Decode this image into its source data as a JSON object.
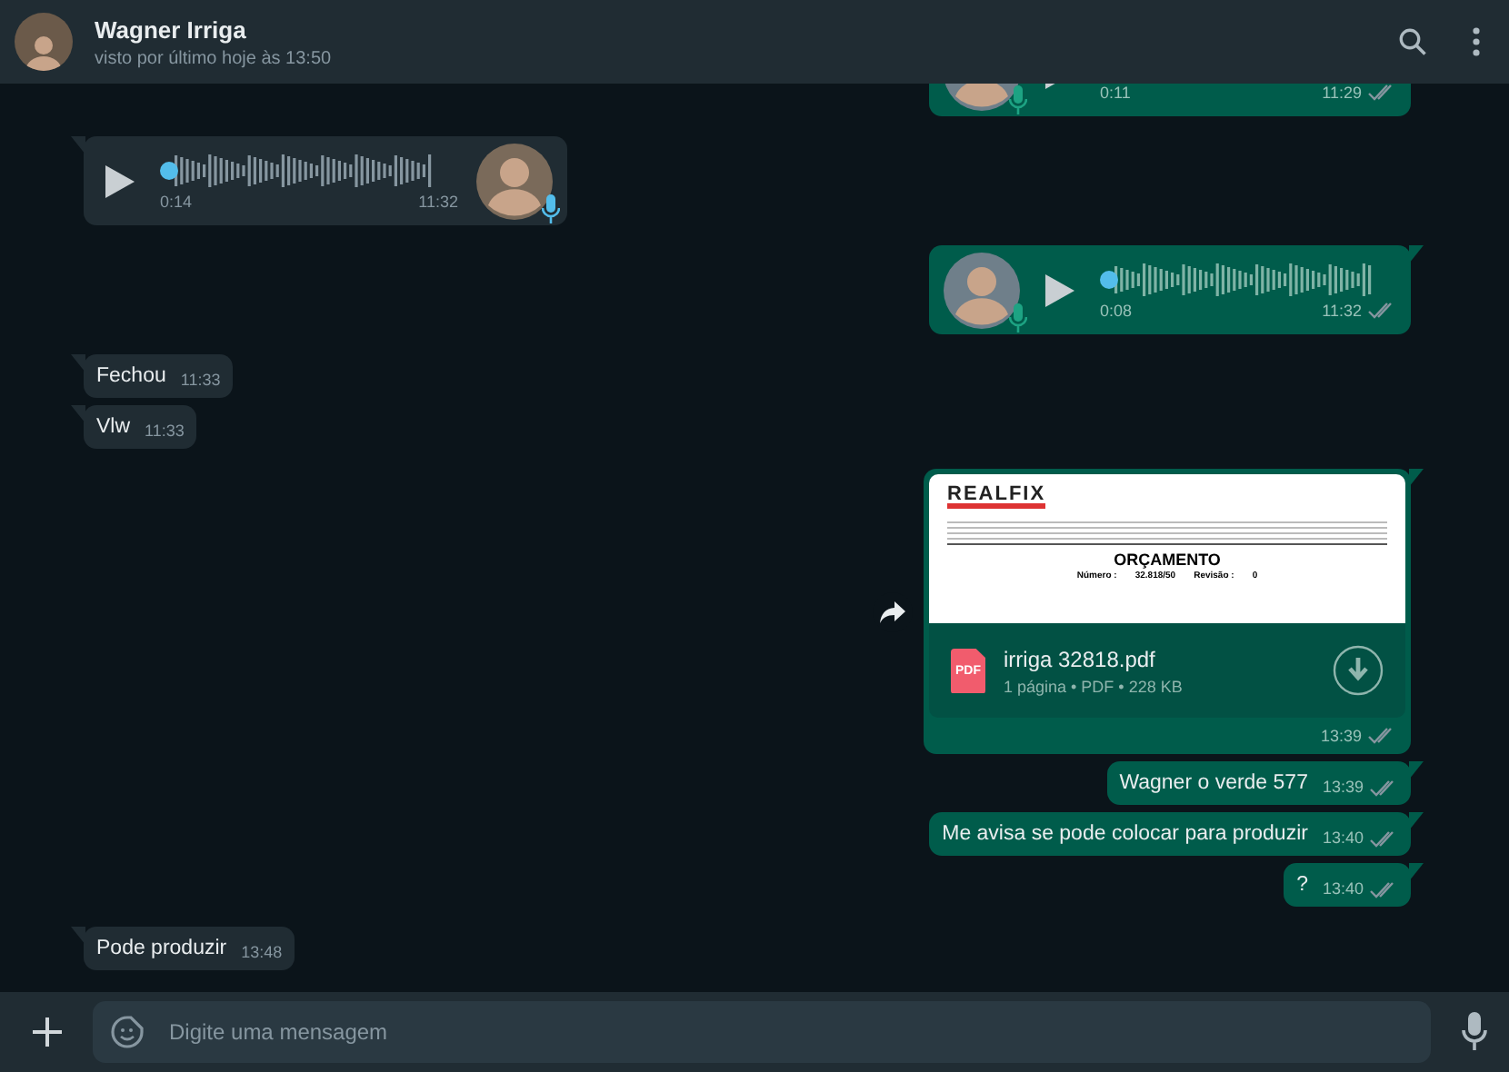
{
  "header": {
    "name": "Wagner Irriga",
    "status": "visto por último hoje às 13:50"
  },
  "messages": [
    {
      "kind": "voice",
      "outgoing": true,
      "duration": "0:11",
      "time": "11:29",
      "read": false
    },
    {
      "kind": "voice",
      "outgoing": false,
      "duration": "0:14",
      "time": "11:32",
      "level": 0
    },
    {
      "kind": "voice",
      "outgoing": true,
      "duration": "0:08",
      "time": "11:32",
      "read": false,
      "level": 0
    },
    {
      "kind": "text",
      "outgoing": false,
      "text": "Fechou",
      "time": "11:33"
    },
    {
      "kind": "text",
      "outgoing": false,
      "text": "Vlw",
      "time": "11:33"
    },
    {
      "kind": "document",
      "outgoing": true,
      "preview": {
        "logo": "REALFIX",
        "title": "ORÇAMENTO",
        "number_label": "Número :",
        "number": "32.818/50",
        "revision_label": "Revisão :",
        "revision": "0"
      },
      "file_badge": "PDF",
      "filename": "irriga 32818.pdf",
      "meta": "1 página • PDF • 228 KB",
      "time": "13:39",
      "read": false
    },
    {
      "kind": "text",
      "outgoing": true,
      "text": "Wagner o verde 577",
      "time": "13:39",
      "read": false
    },
    {
      "kind": "text",
      "outgoing": true,
      "text": "Me avisa se pode colocar para produzir",
      "time": "13:40",
      "read": false
    },
    {
      "kind": "text",
      "outgoing": true,
      "text": "?",
      "time": "13:40",
      "read": false
    },
    {
      "kind": "text",
      "outgoing": false,
      "text": "Pode produzir",
      "time": "13:48"
    }
  ],
  "composer": {
    "placeholder": "Digite uma mensagem"
  }
}
